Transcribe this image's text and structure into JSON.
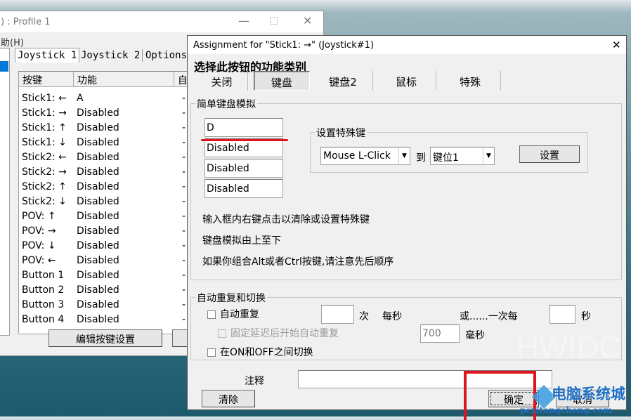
{
  "main_window": {
    "title": ") : Profile 1",
    "menu": "助(H)",
    "tabs": [
      "Joystick 1",
      "Joystick 2",
      "Options"
    ],
    "columns": [
      "按键",
      "功能",
      "自"
    ],
    "rows": [
      [
        "Stick1: ←",
        "A"
      ],
      [
        "Stick1: →",
        "Disabled"
      ],
      [
        "Stick1: ↑",
        "Disabled"
      ],
      [
        "Stick1: ↓",
        "Disabled"
      ],
      [
        "Stick2: ←",
        "Disabled"
      ],
      [
        "Stick2: →",
        "Disabled"
      ],
      [
        "Stick2: ↑",
        "Disabled"
      ],
      [
        "Stick2: ↓",
        "Disabled"
      ],
      [
        "POV: ↑",
        "Disabled"
      ],
      [
        "POV: →",
        "Disabled"
      ],
      [
        "POV: ↓",
        "Disabled"
      ],
      [
        "POV: ←",
        "Disabled"
      ],
      [
        "Button 1",
        "Disabled"
      ],
      [
        "Button 2",
        "Disabled"
      ],
      [
        "Button 3",
        "Disabled"
      ],
      [
        "Button 4",
        "Disabled"
      ]
    ],
    "edit_button": "编辑按键设置"
  },
  "dialog": {
    "title": "Assignment for \"Stick1: →\" (Joystick#1)",
    "close": "✕",
    "heading": "选择此按钮的功能类别",
    "tabs": [
      "关闭",
      "键盘",
      "键盘2",
      "鼠标",
      "特殊"
    ],
    "active_tab": "键盘",
    "simple_group": "简单键盘模拟",
    "keys": [
      "D",
      "Disabled",
      "Disabled",
      "Disabled"
    ],
    "special_group": "设置特殊键",
    "special_select": "Mouse L-Click",
    "to": "到",
    "slot_select": "键位1",
    "set_button": "设置",
    "hints": [
      "输入框内右键点击以清除或设置特殊键",
      "键盘模拟由上至下",
      "如果你组合Alt或者Ctrl按键,请注意先后顺序"
    ],
    "repeat_group": "自动重复和切换",
    "auto_repeat": "自动重复",
    "times": "次",
    "per_second": "每秒",
    "or_every": "或......一次每",
    "seconds": "秒",
    "fixed_delay": "固定延迟后开始自动重复",
    "delay_value": "700",
    "ms": "毫秒",
    "toggle": "在ON和OFF之间切换",
    "note_label": "注释",
    "note_value": "",
    "clear": "清除",
    "ok": "确定",
    "cancel": "取消"
  },
  "watermarks": [
    "HWIDC",
    "电脑系统城",
    "pcxitongcheng.com"
  ],
  "colors": {
    "annotation_red": "#e0141e",
    "selection_blue": "#0078d7"
  }
}
